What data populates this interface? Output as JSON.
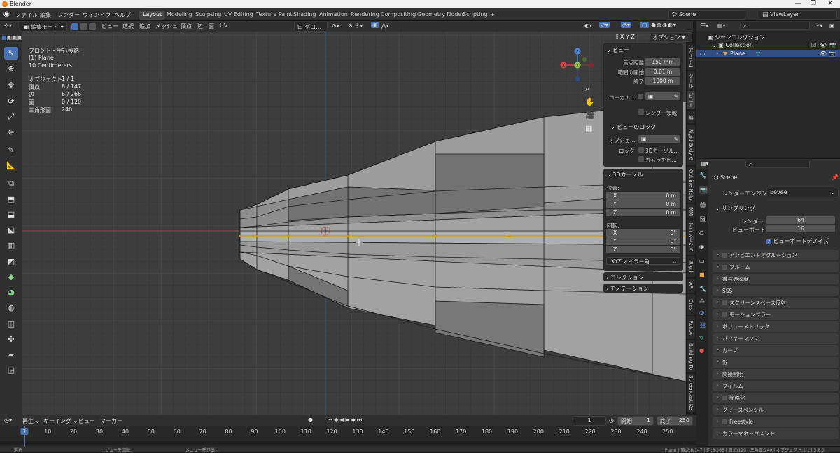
{
  "window": {
    "title": "Blender",
    "minimize": "—",
    "maximize": "❐",
    "close": "✕"
  },
  "menu": {
    "items": [
      "ファイル",
      "編集",
      "レンダー",
      "ウィンドウ",
      "ヘルプ"
    ]
  },
  "workspaces": {
    "tabs": [
      "Layout",
      "Modeling",
      "Sculpting",
      "UV Editing",
      "Texture Paint",
      "Shading",
      "Animation",
      "Rendering",
      "Compositing",
      "Geometry Nodes",
      "Scripting"
    ],
    "active": "Layout",
    "add": "+"
  },
  "scene": {
    "name": "Scene",
    "view_layer": "ViewLayer"
  },
  "header3d": {
    "mode": "編集モード",
    "menus": [
      "ビュー",
      "選択",
      "追加",
      "メッシュ",
      "頂点",
      "辺",
      "面",
      "UV"
    ],
    "orientation": "グロ…",
    "axes": [
      "X",
      "Y",
      "Z"
    ],
    "options": "オプション"
  },
  "overlay_text": {
    "view_name": "フロント・平行投影",
    "object_name": "(1) Plane",
    "scale": "10 Centimeters",
    "stats": [
      {
        "label": "オブジェクト",
        "value": "1 / 1"
      },
      {
        "label": "頂点",
        "value": "8 / 147"
      },
      {
        "label": "辺",
        "value": "6 / 266"
      },
      {
        "label": "面",
        "value": "0 / 120"
      },
      {
        "label": "三角形面",
        "value": "240"
      }
    ]
  },
  "gizmo": {
    "x": "X",
    "y": "Y",
    "z": "Z"
  },
  "npanel": {
    "view": {
      "title": "ビュー",
      "focal_label": "焦点距離",
      "focal": "150 mm",
      "clip_start_label": "範囲の開始",
      "clip_start": "0.01 m",
      "clip_end_label": "終了",
      "clip_end": "1000 m",
      "local_label": "ローカル…",
      "render_region": "レンダー領域"
    },
    "lock": {
      "title": "ビューのロック",
      "object_label": "オブジェ…",
      "lock_label": "ロック",
      "to_cursor": "3Dカーソル…",
      "camera": "カメラをビ…"
    },
    "cursor": {
      "title": "3Dカーソル",
      "location": "位置:",
      "x_label": "X",
      "x": "0 m",
      "y_label": "Y",
      "y": "0 m",
      "z_label": "Z",
      "z": "0 m",
      "rotation": "回転:",
      "rx": "0°",
      "ry": "0°",
      "rz": "0°",
      "mode": "XYZ オイラー角"
    },
    "collection": "コレクション",
    "annotation": "アノテーション"
  },
  "vtabs": [
    "アイテム",
    "ツール",
    "ビュー",
    "編",
    "Rigid Body G",
    "Outline Help",
    "MM",
    "アニメーショ",
    "Rigif",
    "AR",
    "Dres",
    "Rokok",
    "Building To",
    "Screencast Ke"
  ],
  "outliner": {
    "root": "シーンコレクション",
    "collection": "Collection",
    "object": "Plane"
  },
  "properties": {
    "scene": "Scene",
    "engine_label": "レンダーエンジン",
    "engine": "Eevee",
    "sampling": "サンプリング",
    "render_label": "レンダー",
    "render_samples": "64",
    "viewport_label": "ビューポート",
    "viewport_samples": "16",
    "denoise": "ビューポートデノイズ",
    "panels": [
      {
        "label": "アンビエントオクルージョン",
        "check": true
      },
      {
        "label": "ブルーム",
        "check": true
      },
      {
        "label": "被写界深度",
        "check": false
      },
      {
        "label": "SSS",
        "check": false
      },
      {
        "label": "スクリーンスペース反射",
        "check": true
      },
      {
        "label": "モーションブラー",
        "check": true
      },
      {
        "label": "ボリューメトリック",
        "check": false
      },
      {
        "label": "パフォーマンス",
        "check": false
      },
      {
        "label": "カーブ",
        "check": false
      },
      {
        "label": "影",
        "check": false
      },
      {
        "label": "間接照明",
        "check": false
      },
      {
        "label": "フィルム",
        "check": false
      },
      {
        "label": "簡略化",
        "check": true
      },
      {
        "label": "グリースペンシル",
        "check": false
      },
      {
        "label": "Freestyle",
        "check": true
      },
      {
        "label": "カラーマネージメント",
        "check": false
      }
    ]
  },
  "timeline": {
    "menus": [
      "再生",
      "キーイング",
      "ビュー",
      "マーカー"
    ],
    "current_frame": "1",
    "start_label": "開始",
    "start": "1",
    "end_label": "終了",
    "end": "250",
    "ticks": [
      "1",
      "10",
      "20",
      "30",
      "40",
      "50",
      "60",
      "70",
      "80",
      "90",
      "100",
      "110",
      "120",
      "130",
      "140",
      "150",
      "160",
      "170",
      "180",
      "190",
      "200",
      "210",
      "220",
      "230",
      "240",
      "250"
    ]
  },
  "status": {
    "left": "選択",
    "mid": "ビューを回転",
    "menu": "メニュー呼び出し",
    "right": "Plane | 頂点:8/147 | 辺:6/266 | 面:0/120 | 三角面:240 | オブジェクト:1/1 | 3.6.0"
  }
}
